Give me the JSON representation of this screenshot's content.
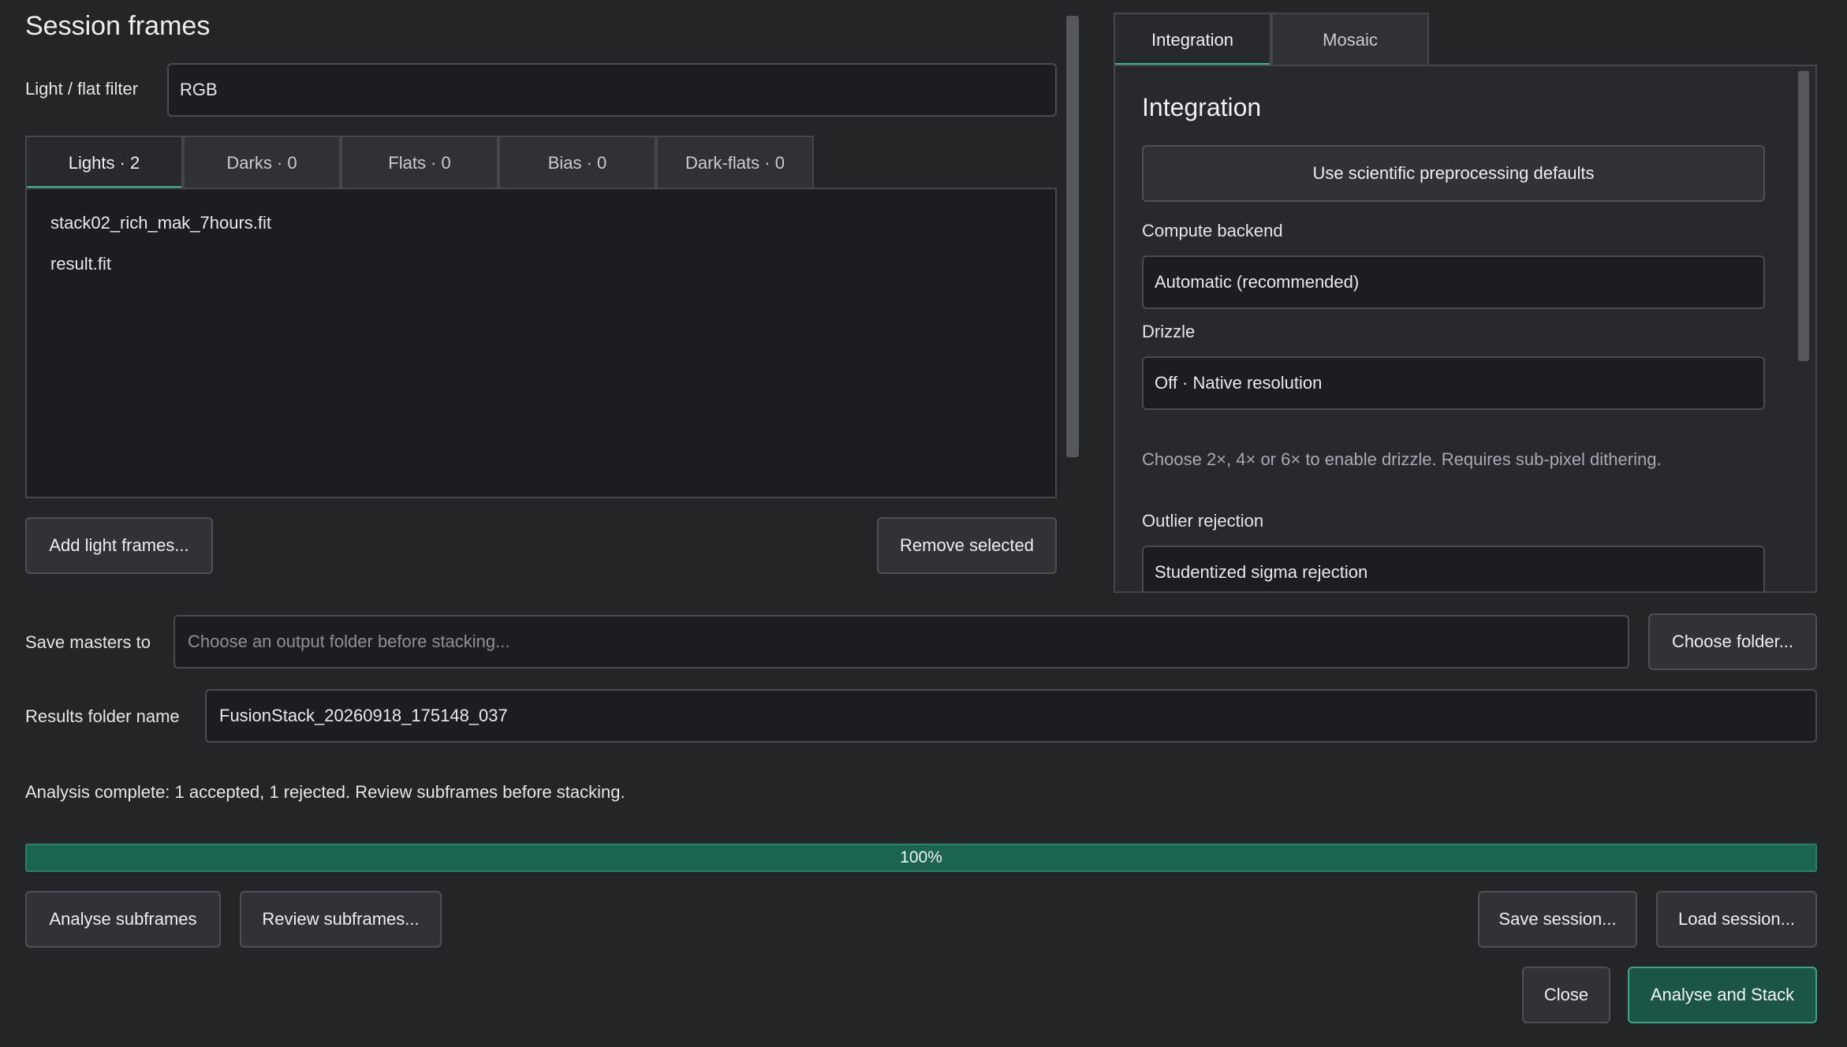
{
  "session_frames": {
    "title": "Session frames",
    "filter_label": "Light / flat filter",
    "filter_value": "RGB",
    "tabs": [
      {
        "label": "Lights · 2"
      },
      {
        "label": "Darks · 0"
      },
      {
        "label": "Flats · 0"
      },
      {
        "label": "Bias · 0"
      },
      {
        "label": "Dark-flats · 0"
      }
    ],
    "files": [
      "stack02_rich_mak_7hours.fit",
      "result.fit"
    ],
    "add_button": "Add light frames...",
    "remove_button": "Remove selected"
  },
  "settings_panel": {
    "tabs": [
      {
        "label": "Integration"
      },
      {
        "label": "Mosaic"
      }
    ],
    "heading": "Integration",
    "defaults_button": "Use scientific preprocessing defaults",
    "compute_backend": {
      "label": "Compute backend",
      "value": "Automatic (recommended)"
    },
    "drizzle": {
      "label": "Drizzle",
      "value": "Off · Native resolution",
      "help": "Choose 2×, 4× or 6× to enable drizzle. Requires sub-pixel dithering."
    },
    "outlier_rejection": {
      "label": "Outlier rejection",
      "value": "Studentized sigma rejection"
    }
  },
  "output": {
    "save_masters_label": "Save masters to",
    "save_masters_placeholder": "Choose an output folder before stacking...",
    "choose_folder_button": "Choose folder...",
    "results_folder_label": "Results folder name",
    "results_folder_value": "FusionStack_20260918_175148_037"
  },
  "status": {
    "message": "Analysis complete: 1 accepted, 1 rejected. Review subframes before stacking.",
    "progress_percent": 100,
    "progress_text": "100%"
  },
  "actions": {
    "analyse": "Analyse subframes",
    "review": "Review subframes...",
    "save_session": "Save session...",
    "load_session": "Load session...",
    "close": "Close",
    "analyse_and_stack": "Analyse and Stack"
  },
  "colors": {
    "background": "#242527",
    "accent": "#39b394",
    "progress_fill": "#1b6550",
    "primary_button": "#1b5546"
  }
}
